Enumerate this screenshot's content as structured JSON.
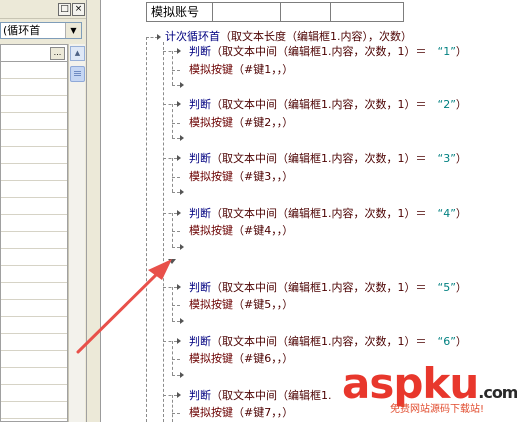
{
  "left_panel": {
    "title_buttons": [
      "□",
      "×"
    ],
    "combo_value": "(循环首",
    "ellipsis_label": "..."
  },
  "header_table": {
    "cells": [
      "模拟账号",
      "",
      "",
      ""
    ]
  },
  "code": {
    "loop": {
      "keyword": "计次循环首",
      "args": "（取文本长度（编辑框1.内容），次数）"
    },
    "blocks": [
      {
        "judge": "判断",
        "fn": "（取文本中间（编辑框1.内容，次数，1）＝",
        "str": "“1”",
        "tail": "）",
        "key_cmd": "模拟按键",
        "key_args": "（#键1，，）"
      },
      {
        "judge": "判断",
        "fn": "（取文本中间（编辑框1.内容，次数，1）＝",
        "str": "“2”",
        "tail": "）",
        "key_cmd": "模拟按键",
        "key_args": "（#键2，，）"
      },
      {
        "judge": "判断",
        "fn": "（取文本中间（编辑框1.内容，次数，1）＝",
        "str": "“3”",
        "tail": "）",
        "key_cmd": "模拟按键",
        "key_args": "（#键3，，）"
      },
      {
        "judge": "判断",
        "fn": "（取文本中间（编辑框1.内容，次数，1）＝",
        "str": "“4”",
        "tail": "）",
        "key_cmd": "模拟按键",
        "key_args": "（#键4，，）"
      },
      {
        "judge": "判断",
        "fn": "（取文本中间（编辑框1.内容，次数，1）＝",
        "str": "“5”",
        "tail": "）",
        "key_cmd": "模拟按键",
        "key_args": "（#键5，，）"
      },
      {
        "judge": "判断",
        "fn": "（取文本中间（编辑框1.内容，次数，1）＝",
        "str": "“6”",
        "tail": "）",
        "key_cmd": "模拟按键",
        "key_args": "（#键6，，）"
      },
      {
        "judge": "判断",
        "fn": "（取文本中间（编辑框1.",
        "str": "",
        "tail": "",
        "key_cmd": "模拟按键",
        "key_args": "（#键7，，）"
      }
    ]
  },
  "watermark": {
    "main": "aspku",
    "suffix": ".com",
    "sub": "免费网站源码下载站!"
  },
  "colors": {
    "annotation_arrow": "#e8504a",
    "watermark_asp": "#e8372c",
    "watermark_ku": "#2a2a2a",
    "string_literal": "#008080",
    "keyword": "#000080"
  }
}
